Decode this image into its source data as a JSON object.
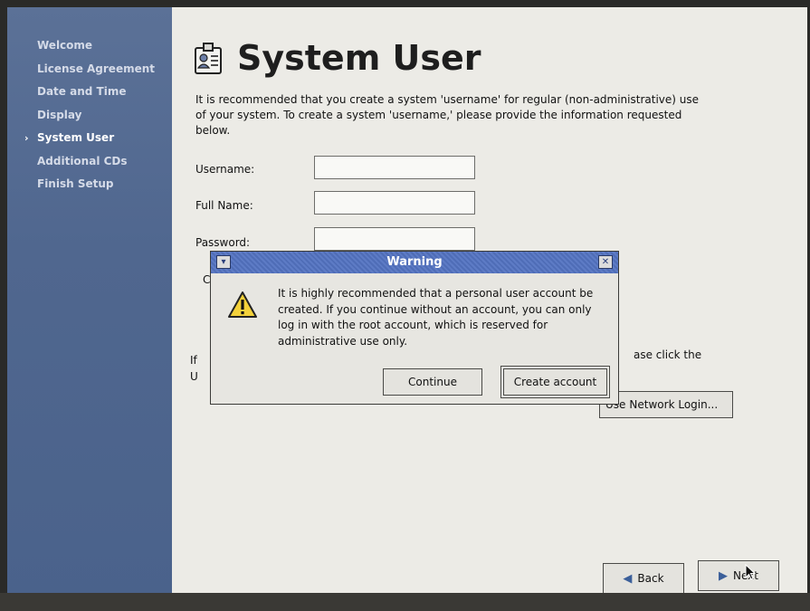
{
  "sidebar": {
    "active_marker": "›",
    "items": [
      {
        "label": "Welcome"
      },
      {
        "label": "License Agreement"
      },
      {
        "label": "Date and Time"
      },
      {
        "label": "Display"
      },
      {
        "label": "System User"
      },
      {
        "label": "Additional CDs"
      },
      {
        "label": "Finish Setup"
      }
    ]
  },
  "main": {
    "title": "System User",
    "title_icon": "user-id-card-icon",
    "intro": "It is recommended that you create a system 'username' for regular (non-administrative) use of your system. To create a system 'username,' please provide the information requested below.",
    "fields": {
      "username_label": "Username:",
      "username_value": "",
      "fullname_label": "Full Name:",
      "fullname_value": "",
      "password_label": "Password:",
      "password_value": ""
    },
    "partial_text": {
      "confirm_fragment": "C",
      "if_fragment": "If",
      "us_fragment": "U",
      "click_fragment": "ase click the"
    },
    "network_login_button": "Network Login...",
    "network_login_prefix": "Use",
    "back_button": "Back",
    "next_button": "Next"
  },
  "dialog": {
    "title": "Warning",
    "icon": "warning-icon",
    "message": "It is highly recommended that a personal user account be created.  If you continue without an account, you can only log in with the root account, which is reserved for administrative use only.",
    "continue_button": "Continue",
    "create_button": "Create account"
  },
  "colors": {
    "sidebar": "#50678f",
    "titlebar": "#5470bb",
    "background": "#ecebe6"
  }
}
